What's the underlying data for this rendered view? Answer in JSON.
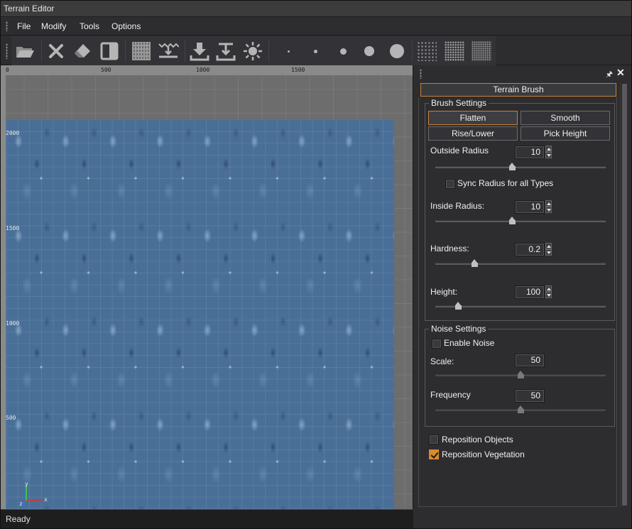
{
  "window": {
    "title": "Terrain Editor"
  },
  "menu": {
    "items": [
      "File",
      "Modify",
      "Tools",
      "Options"
    ]
  },
  "toolbar": {
    "buttons": [
      "open-folder-icon",
      "delete-icon",
      "eraser-icon",
      "split-view-icon",
      "texture-icon",
      "water-level-icon",
      "import-icon",
      "export-icon",
      "lighting-icon"
    ],
    "brush_sizes": [
      "brush-size-1",
      "brush-size-2",
      "brush-size-3",
      "brush-size-4",
      "brush-size-5"
    ],
    "patterns": [
      "sparse-pattern",
      "medium-pattern",
      "dense-pattern"
    ]
  },
  "viewport": {
    "ruler_top": [
      "0",
      "500",
      "1000",
      "1500"
    ],
    "ruler_left": [
      "2000",
      "1500",
      "1000",
      "500"
    ],
    "axis_y": "y",
    "axis_x": "x",
    "axis_z": "z"
  },
  "status": {
    "text": "Ready"
  },
  "panel": {
    "tab": "Terrain Brush",
    "brush": {
      "title": "Brush Settings",
      "flatten": "Flatten",
      "smooth": "Smooth",
      "rise_lower": "Rise/Lower",
      "pick_height": "Pick Height",
      "outside_radius_label": "Outside Radius",
      "outside_radius": "10",
      "outside_radius_level": 0.45,
      "sync_label": "Sync Radius for all Types",
      "sync_checked": false,
      "inside_radius_label": "Inside Radius:",
      "inside_radius": "10",
      "inside_radius_level": 0.45,
      "hardness_label": "Hardness:",
      "hardness": "0.2",
      "hardness_level": 0.22,
      "height_label": "Height:",
      "height": "100",
      "height_level": 0.12
    },
    "noise": {
      "title": "Noise Settings",
      "enable_label": "Enable Noise",
      "enable_checked": false,
      "scale_label": "Scale:",
      "scale": "50",
      "scale_level": 0.5,
      "frequency_label": "Frequency",
      "frequency": "50",
      "frequency_level": 0.5
    },
    "reposition_objects": "Reposition Objects",
    "reposition_objects_checked": false,
    "reposition_vegetation": "Reposition Vegetation",
    "reposition_vegetation_checked": true
  },
  "colors": {
    "accent": "#d98a2b",
    "terrain": "#4a6f97",
    "background": "#2d2d30"
  }
}
